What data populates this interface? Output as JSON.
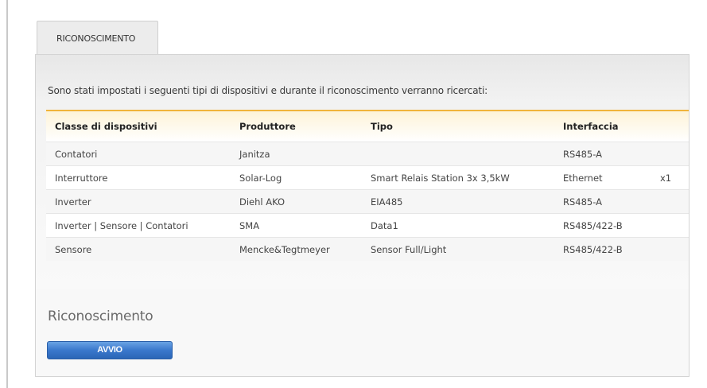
{
  "tab": {
    "label": "RICONOSCIMENTO"
  },
  "intro_text": "Sono stati impostati i seguenti tipi di dispositivi e durante il riconoscimento verranno ricercati:",
  "table": {
    "headers": [
      "Classe di dispositivi",
      "Produttore",
      "Tipo",
      "Interfaccia",
      ""
    ],
    "rows": [
      [
        "Contatori",
        "Janitza",
        "",
        "RS485-A",
        ""
      ],
      [
        "Interruttore",
        "Solar-Log",
        "Smart Relais Station 3x 3,5kW",
        "Ethernet",
        "x1"
      ],
      [
        "Inverter",
        "Diehl AKO",
        "EIA485",
        "RS485-A",
        ""
      ],
      [
        "Inverter | Sensore | Contatori",
        "SMA",
        "Data1",
        "RS485/422-B",
        ""
      ],
      [
        "Sensore",
        "Mencke&Tegtmeyer",
        "Sensor Full/Light",
        "RS485/422-B",
        ""
      ]
    ]
  },
  "section": {
    "title": "Riconoscimento",
    "start_button": "AVVIO"
  },
  "colors": {
    "accent_border": "#f0b43c",
    "button_blue": "#3a78cc"
  }
}
